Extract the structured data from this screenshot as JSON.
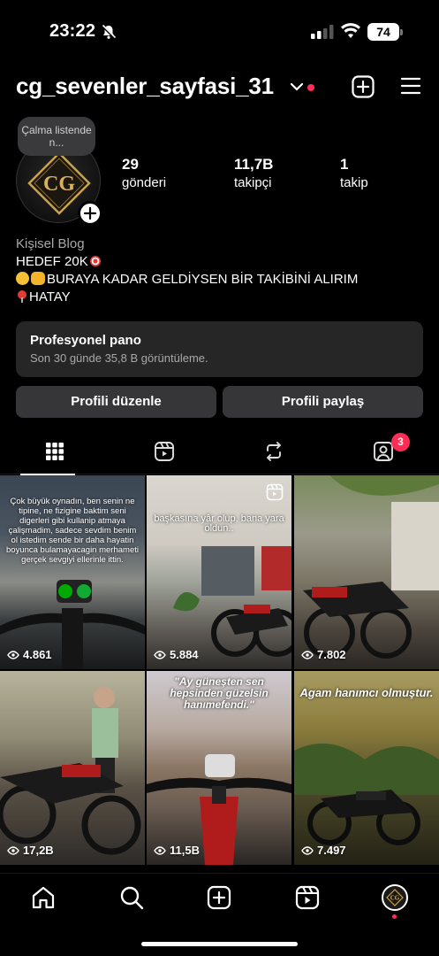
{
  "status_bar": {
    "time": "23:22",
    "battery": "74"
  },
  "header": {
    "username": "cg_sevenler_sayfasi_31"
  },
  "profile": {
    "note": "Çalma listende n...",
    "stats": [
      {
        "value": "29",
        "label": "gönderi"
      },
      {
        "value": "11,7B",
        "label": "takipçi"
      },
      {
        "value": "1",
        "label": "takip"
      }
    ],
    "bio": {
      "category": "Kişisel Blog",
      "line1": "HEDEF 20K",
      "line2": "BURAYA KADAR GELDİYSEN BİR TAKİBİNİ ALIRIM",
      "line3": "HATAY"
    }
  },
  "dashboard": {
    "title": "Profesyonel pano",
    "subtitle": "Son 30 günde 35,8 B görüntüleme."
  },
  "buttons": {
    "edit": "Profili düzenle",
    "share": "Profili paylaş"
  },
  "tabs": {
    "tagged_badge": "3"
  },
  "grid": [
    {
      "views": "4.861",
      "caption": "Çok büyük oynadın, ben senin ne tipine, ne fizigine baktim seni digerleri gibi kullanip atmaya çalişmadim, sadece sevdim benim ol istedim sende bir daha hayatin boyunca bulamayacagin merhameti gerçek sevgiyi ellerinle ittin."
    },
    {
      "views": "5.884",
      "caption": "başkasına yâr olup, bana yara oldun.."
    },
    {
      "views": "7.802",
      "caption": ""
    },
    {
      "views": "17,2B",
      "caption": ""
    },
    {
      "views": "11,5B",
      "caption": "\"Ay güneşten sen hepsinden güzelsin hanımefendi.\""
    },
    {
      "views": "7.497",
      "caption": "Agam hanımcı olmuştur."
    }
  ],
  "colors": {
    "accent": "#ff2d55",
    "background": "#000000",
    "button": "#363638",
    "card": "#262626"
  }
}
